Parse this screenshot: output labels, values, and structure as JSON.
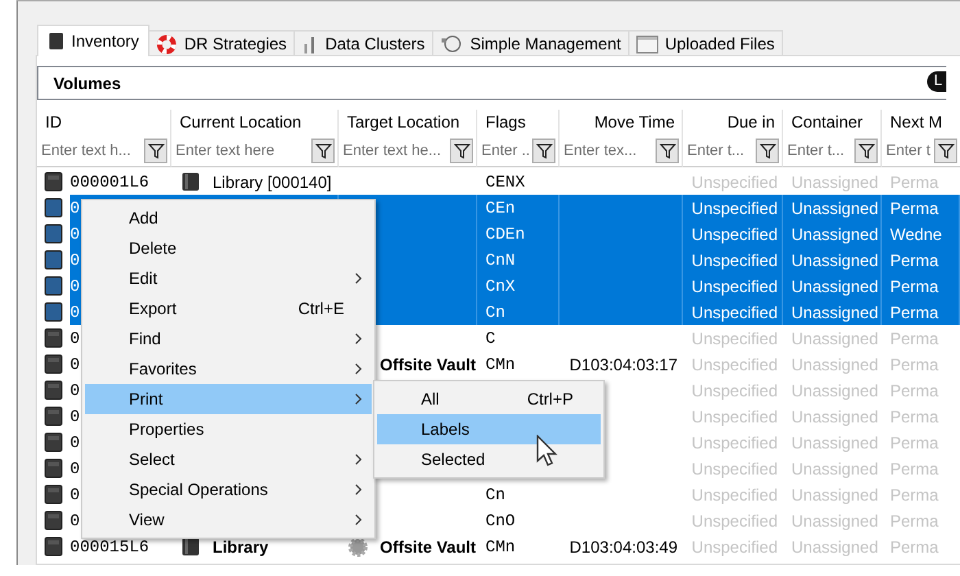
{
  "tabs": [
    {
      "label": "Inventory",
      "selected": true
    },
    {
      "label": "DR Strategies",
      "selected": false
    },
    {
      "label": "Data Clusters",
      "selected": false
    },
    {
      "label": "Simple Management",
      "selected": false
    },
    {
      "label": "Uploaded Files",
      "selected": false
    }
  ],
  "panel": {
    "title": "Volumes",
    "badge": "L"
  },
  "columns": [
    {
      "label": "ID",
      "placeholder": "Enter text h..."
    },
    {
      "label": "Current Location",
      "placeholder": "Enter text here"
    },
    {
      "label": "Target Location",
      "placeholder": "Enter text he..."
    },
    {
      "label": "Flags",
      "placeholder": "Enter ..."
    },
    {
      "label": "Move Time",
      "placeholder": "Enter tex..."
    },
    {
      "label": "Due in",
      "placeholder": "Enter t..."
    },
    {
      "label": "Container",
      "placeholder": "Enter t..."
    },
    {
      "label": "Next M",
      "placeholder": "Enter t"
    }
  ],
  "rows": [
    {
      "selected": false,
      "id": "000001L6",
      "current_location": {
        "text": "Library [000140]",
        "bold": false,
        "kind": "library"
      },
      "flags": "CENX",
      "due_in": "Unspecified",
      "container": "Unassigned",
      "next_m": "Perma"
    },
    {
      "selected": true,
      "id": "0",
      "flags": "CEn",
      "due_in": "Unspecified",
      "container": "Unassigned",
      "next_m": "Perma"
    },
    {
      "selected": true,
      "id": "0",
      "flags": "CDEn",
      "due_in": "Unspecified",
      "container": "Unassigned",
      "next_m": "Wedne"
    },
    {
      "selected": true,
      "id": "0",
      "flags": "CnN",
      "due_in": "Unspecified",
      "container": "Unassigned",
      "next_m": "Perma"
    },
    {
      "selected": true,
      "id": "0",
      "flags": "CnX",
      "due_in": "Unspecified",
      "container": "Unassigned",
      "next_m": "Perma"
    },
    {
      "selected": true,
      "id": "0",
      "flags": "Cn",
      "due_in": "Unspecified",
      "container": "Unassigned",
      "next_m": "Perma"
    },
    {
      "selected": false,
      "id": "0",
      "flags": "C",
      "due_in": "Unspecified",
      "container": "Unassigned",
      "next_m": "Perma"
    },
    {
      "selected": false,
      "id": "0",
      "target_location": {
        "text": "Offsite Vault",
        "bold": true
      },
      "flags": "CMn",
      "move_time": "D103:04:03:17",
      "due_in": "Unspecified",
      "container": "Unassigned",
      "next_m": "Perma"
    },
    {
      "selected": false,
      "id": "0",
      "due_in": "Unspecified",
      "container": "Unassigned",
      "next_m": "Perma"
    },
    {
      "selected": false,
      "id": "0",
      "due_in": "Unspecified",
      "container": "Unassigned",
      "next_m": "Perma"
    },
    {
      "selected": false,
      "id": "0",
      "due_in": "Unspecified",
      "container": "Unassigned",
      "next_m": "Perma"
    },
    {
      "selected": false,
      "id": "0",
      "due_in": "Unspecified",
      "container": "Unassigned",
      "next_m": "Perma"
    },
    {
      "selected": false,
      "id": "0",
      "flags": "Cn",
      "due_in": "Unspecified",
      "container": "Unassigned",
      "next_m": "Perma"
    },
    {
      "selected": false,
      "id": "0",
      "flags": "CnO",
      "due_in": "Unspecified",
      "container": "Unassigned",
      "next_m": "Perma"
    },
    {
      "selected": false,
      "id": "000015L6",
      "current_location": {
        "text": "Library",
        "bold": true,
        "kind": "library"
      },
      "target_location": {
        "text": "Offsite Vault",
        "bold": true,
        "kind": "vault"
      },
      "flags": "CMn",
      "move_time": "D103:04:03:49",
      "due_in": "Unspecified",
      "container": "Unassigned",
      "next_m": "Perma"
    }
  ],
  "context_menu": {
    "items": [
      {
        "label": "Add",
        "submenu": false,
        "selected": false
      },
      {
        "label": "Delete",
        "submenu": false,
        "selected": false
      },
      {
        "label": "Edit",
        "submenu": true,
        "selected": false
      },
      {
        "label": "Export",
        "shortcut": "Ctrl+E",
        "submenu": false,
        "selected": false
      },
      {
        "label": "Find",
        "submenu": true,
        "selected": false
      },
      {
        "label": "Favorites",
        "submenu": true,
        "selected": false
      },
      {
        "label": "Print",
        "submenu": true,
        "selected": true
      },
      {
        "label": "Properties",
        "submenu": false,
        "selected": false
      },
      {
        "label": "Select",
        "submenu": true,
        "selected": false
      },
      {
        "label": "Special Operations",
        "submenu": true,
        "selected": false
      },
      {
        "label": "View",
        "submenu": true,
        "selected": false
      }
    ],
    "submenu": [
      {
        "label": "All",
        "shortcut": "Ctrl+P",
        "selected": false
      },
      {
        "label": "Labels",
        "selected": true
      },
      {
        "label": "Selected",
        "selected": false
      }
    ]
  }
}
